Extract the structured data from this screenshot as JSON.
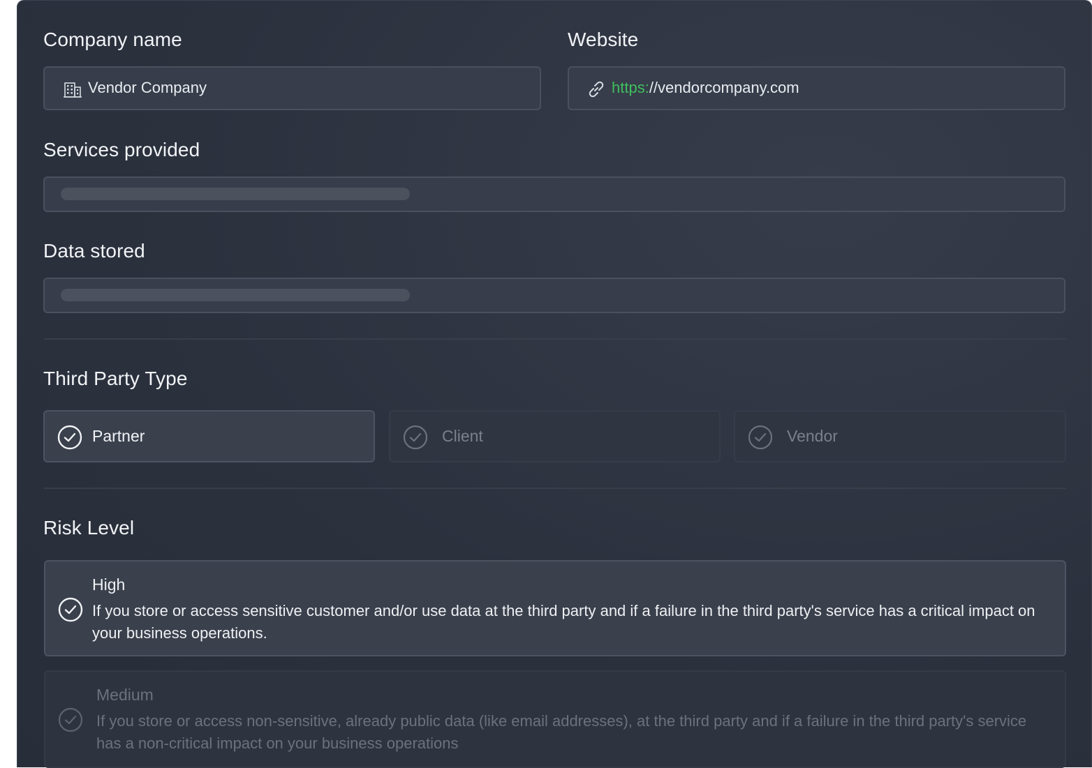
{
  "form": {
    "company_name": {
      "label": "Company name",
      "value": "Vendor Company",
      "icon": "building-icon"
    },
    "website": {
      "label": "Website",
      "protocol": "https:",
      "rest": "//vendorcompany.com",
      "icon": "link-icon",
      "accent_color": "#3fbf5e"
    },
    "services_provided": {
      "label": "Services provided"
    },
    "data_stored": {
      "label": "Data stored"
    },
    "third_party_type": {
      "label": "Third Party Type",
      "options": [
        {
          "label": "Partner",
          "selected": true
        },
        {
          "label": "Client",
          "selected": false
        },
        {
          "label": "Vendor",
          "selected": false
        }
      ]
    },
    "risk_level": {
      "label": "Risk Level",
      "options": [
        {
          "title": "High",
          "description": "If you store or access sensitive customer and/or use data at the third party and if a failure in the third party's service has a critical impact on your business operations.",
          "selected": true
        },
        {
          "title": "Medium",
          "description": "If you store or access non-sensitive, already public data (like email addresses), at the third party and if a failure in the third party's service has a non-critical impact on your business operations",
          "selected": false
        }
      ]
    }
  }
}
